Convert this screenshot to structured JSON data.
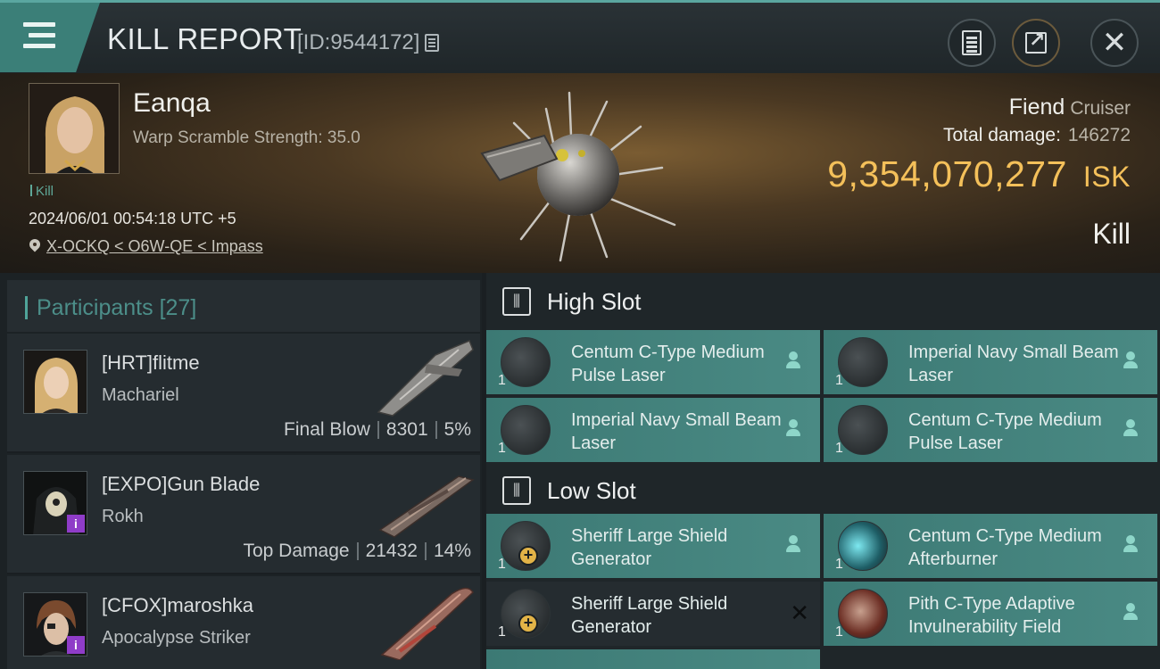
{
  "header": {
    "title": "KILL REPORT",
    "report_id": "[ID:9544172]"
  },
  "victim": {
    "name": "Eanqa",
    "warp_scramble": "Warp Scramble Strength: 35.0",
    "tag": "Kill",
    "datetime": "2024/06/01 00:54:18 UTC +5",
    "location": "X-OCKQ < O6W-QE < Impass",
    "ship_name": "Fiend",
    "ship_class": "Cruiser",
    "total_damage_label": "Total damage:",
    "total_damage_value": "146272",
    "isk_value": "9,354,070,277",
    "isk_unit": "ISK",
    "result": "Kill"
  },
  "participants": {
    "title": "Participants",
    "count": "[27]",
    "rows": [
      {
        "name": "[HRT]flitme",
        "ship": "Machariel",
        "role": "Final Blow",
        "damage": "8301",
        "percent": "5%"
      },
      {
        "name": "[EXPO]Gun Blade",
        "ship": "Rokh",
        "role": "Top Damage",
        "damage": "21432",
        "percent": "14%"
      },
      {
        "name": "[CFOX]maroshka",
        "ship": "Apocalypse Striker",
        "role": "",
        "damage": "",
        "percent": ""
      }
    ]
  },
  "fitting": {
    "high_slot": {
      "title": "High Slot",
      "modules": [
        {
          "name": "Centum C-Type Medium Pulse Laser",
          "qty": "1"
        },
        {
          "name": "Imperial Navy Small Beam Laser",
          "qty": "1"
        },
        {
          "name": "Imperial Navy Small Beam Laser",
          "qty": "1"
        },
        {
          "name": "Centum C-Type Medium Pulse Laser",
          "qty": "1"
        }
      ]
    },
    "low_slot": {
      "title": "Low Slot",
      "modules": [
        {
          "name": "Sheriff Large Shield Generator",
          "qty": "1"
        },
        {
          "name": "Centum C-Type Medium Afterburner",
          "qty": "1"
        },
        {
          "name": "Sheriff Large Shield Generator",
          "qty": "1"
        },
        {
          "name": "Pith C-Type Adaptive Invulnerability Field",
          "qty": "1"
        }
      ]
    }
  },
  "colors": {
    "accent_teal": "#4a8a84",
    "isk_gold": "#f4c05a",
    "badge_purple": "#8f3cc8"
  }
}
